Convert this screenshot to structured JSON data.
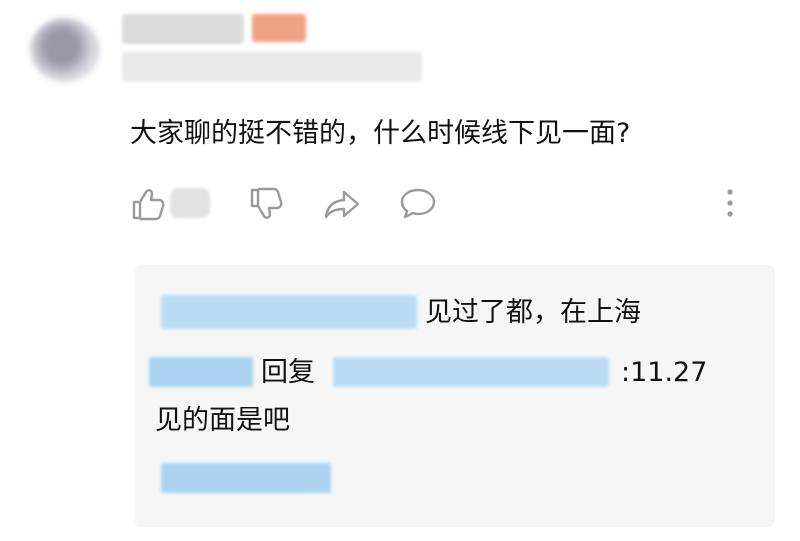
{
  "comment": {
    "text": "大家聊的挺不错的，什么时候线下见一面?"
  },
  "actions": {
    "like_icon": "thumbs-up-icon",
    "dislike_icon": "thumbs-down-icon",
    "share_icon": "share-arrow-icon",
    "reply_icon": "speech-bubble-icon",
    "more_icon": "vertical-ellipsis-icon"
  },
  "replies": {
    "first_text": "见过了都，在上海",
    "reply_word": "回复",
    "second_suffix": ":11.27",
    "second_line2": "见的面是吧"
  },
  "colors": {
    "text": "#111111",
    "icon": "#9a9a9a",
    "reply_bg": "#f6f6f6",
    "redaction_blue": "#a9d3f0",
    "tag_orange": "#f2a383"
  }
}
